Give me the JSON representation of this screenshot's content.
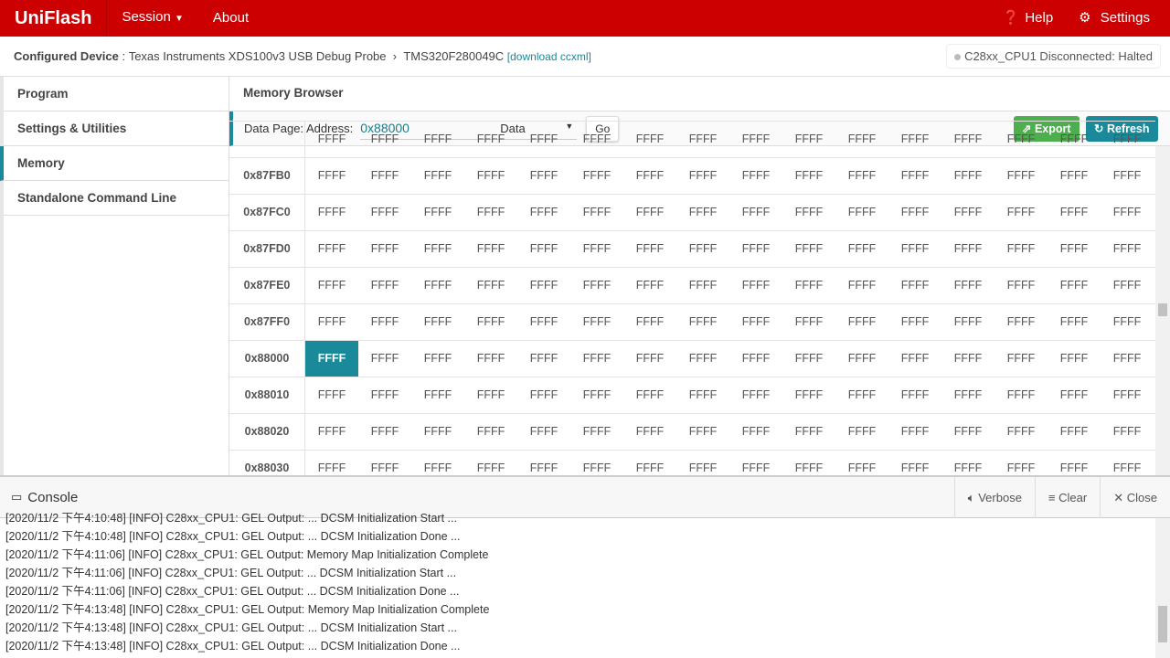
{
  "topbar": {
    "brand": "UniFlash",
    "session": "Session",
    "about": "About",
    "help": "Help",
    "settings": "Settings",
    "color": "#cc0000"
  },
  "device": {
    "label": "Configured Device",
    "probe": "Texas Instruments XDS100v3 USB Debug Probe",
    "target": "TMS320F280049C",
    "download": "[download ccxml]",
    "status": "C28xx_CPU1 Disconnected: Halted"
  },
  "sidebar": {
    "items": [
      {
        "label": "Program"
      },
      {
        "label": "Settings & Utilities"
      },
      {
        "label": "Memory"
      },
      {
        "label": "Standalone Command Line"
      }
    ]
  },
  "memory": {
    "title": "Memory Browser",
    "addr_label": "Data Page: Address:",
    "address": "0x88000",
    "page": "Data",
    "go": "Go",
    "export": "Export",
    "refresh": "Refresh",
    "rows": [
      {
        "addr": ""
      },
      {
        "addr": "0x87FB0"
      },
      {
        "addr": "0x87FC0"
      },
      {
        "addr": "0x87FD0"
      },
      {
        "addr": "0x87FE0"
      },
      {
        "addr": "0x87FF0"
      },
      {
        "addr": "0x88000"
      },
      {
        "addr": "0x88010"
      },
      {
        "addr": "0x88020"
      },
      {
        "addr": "0x88030"
      }
    ],
    "cell_value": "FFFF",
    "selected_address": "0x88000"
  },
  "console": {
    "title": "Console",
    "verbose": "Verbose",
    "clear": "Clear",
    "close": "Close",
    "lines": [
      "[2020/11/2 下午4:10:48] [INFO] C28xx_CPU1: GEL Output: ... DCSM Initialization Start ...",
      "[2020/11/2 下午4:10:48] [INFO] C28xx_CPU1: GEL Output: ... DCSM Initialization Done ...",
      "[2020/11/2 下午4:11:06] [INFO] C28xx_CPU1: GEL Output: Memory Map Initialization Complete",
      "[2020/11/2 下午4:11:06] [INFO] C28xx_CPU1: GEL Output: ... DCSM Initialization Start ...",
      "[2020/11/2 下午4:11:06] [INFO] C28xx_CPU1: GEL Output: ... DCSM Initialization Done ...",
      "[2020/11/2 下午4:13:48] [INFO] C28xx_CPU1: GEL Output: Memory Map Initialization Complete",
      "[2020/11/2 下午4:13:48] [INFO] C28xx_CPU1: GEL Output: ... DCSM Initialization Start ...",
      "[2020/11/2 下午4:13:48] [INFO] C28xx_CPU1: GEL Output: ... DCSM Initialization Done ..."
    ]
  }
}
